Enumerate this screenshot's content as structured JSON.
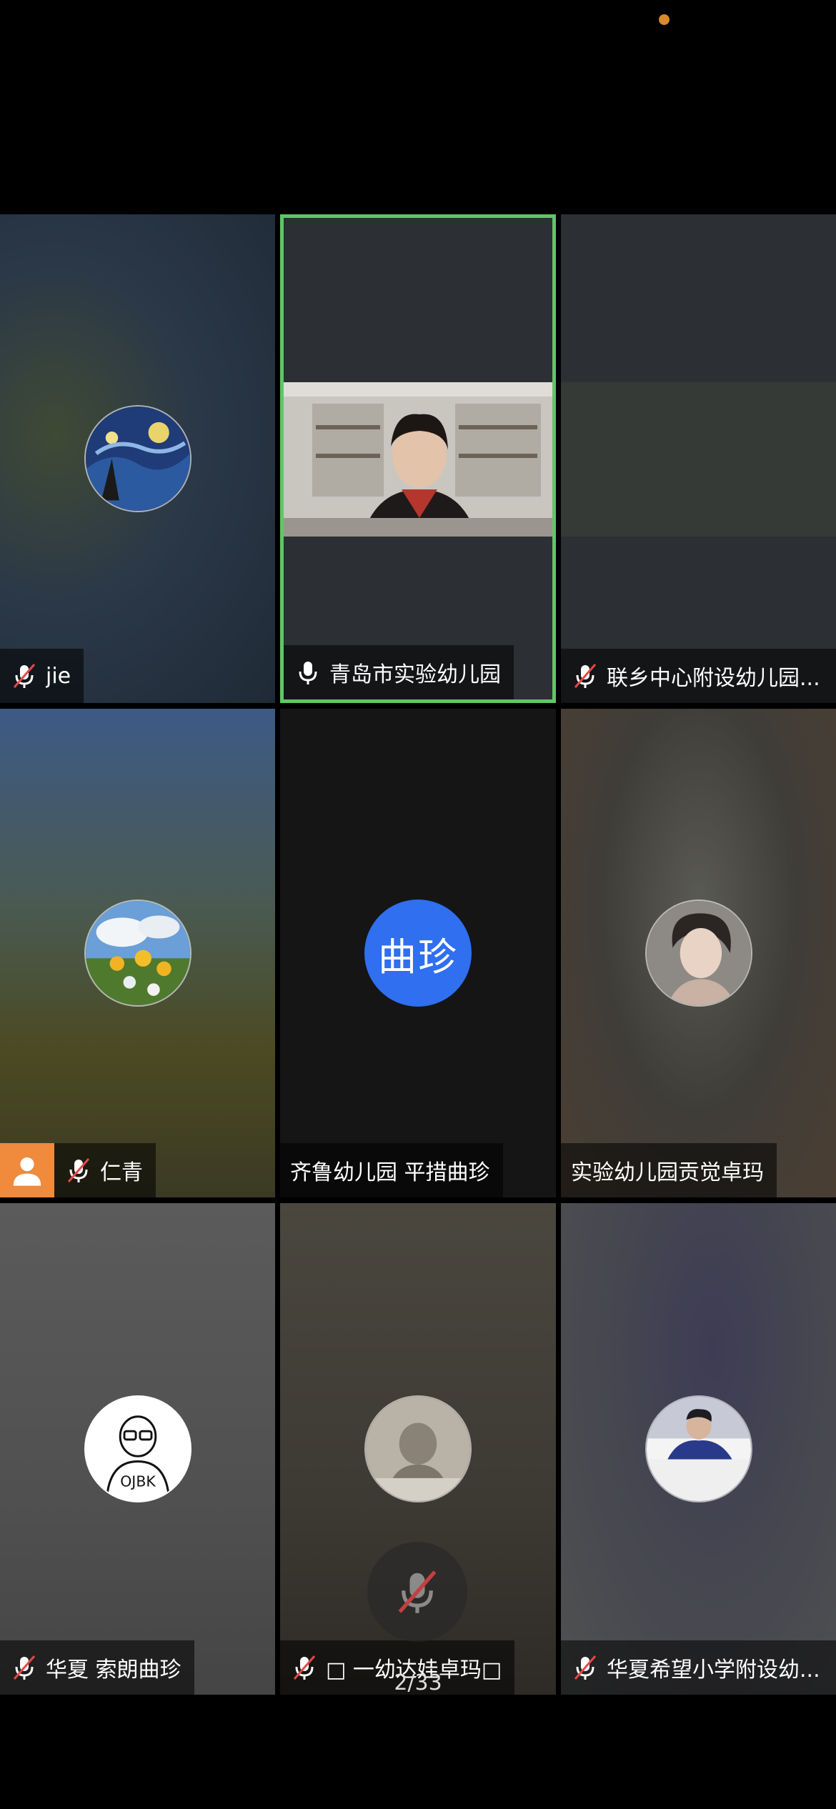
{
  "status_bar": {
    "indicator_color": "#d98a2b"
  },
  "colors": {
    "active_speaker": "#5fc765",
    "host_badge": "#f08a3c",
    "text_avatar": "#2f6ff0"
  },
  "participants": [
    {
      "name": "jie",
      "mic": "muted",
      "avatar": "starry-night-avatar"
    },
    {
      "name": "青岛市实验幼儿园",
      "mic": "on",
      "video": "video-on",
      "active": true
    },
    {
      "name": "联乡中心附设幼儿园...",
      "mic": "muted",
      "video": "video-on"
    },
    {
      "name": "仁青",
      "mic": "muted",
      "avatar": "dandelion-avatar",
      "host": true
    },
    {
      "name": "齐鲁幼儿园 平措曲珍",
      "mic": "none",
      "avatar_text": "曲珍"
    },
    {
      "name": "实验幼儿园贡觉卓玛",
      "mic": "none",
      "avatar": "portrait-avatar"
    },
    {
      "name": "华夏 索朗曲珍",
      "mic": "muted",
      "avatar": "ojbk-avatar",
      "avatar_text": "OJBK"
    },
    {
      "name": "□ 一幼达娃卓玛□",
      "mic": "muted",
      "avatar": "baby-avatar"
    },
    {
      "name": "华夏希望小学附设幼...",
      "mic": "muted",
      "avatar": "student-avatar"
    }
  ],
  "pager": {
    "text": "2/33"
  },
  "floating_control": {
    "icon": "mic-muted-icon"
  }
}
